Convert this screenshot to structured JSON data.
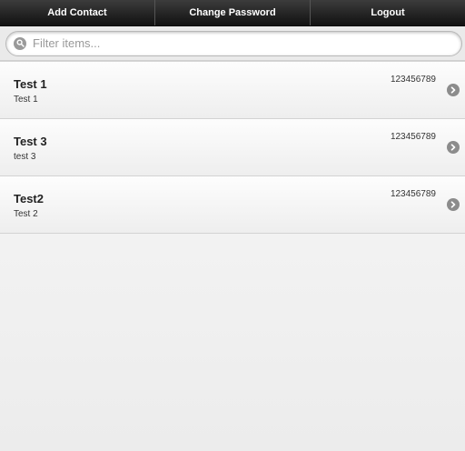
{
  "navbar": {
    "items": [
      {
        "label": "Add Contact"
      },
      {
        "label": "Change Password"
      },
      {
        "label": "Logout"
      }
    ]
  },
  "filter": {
    "placeholder": "Filter items...",
    "icon": "search-icon"
  },
  "contacts": [
    {
      "name": "Test 1",
      "detail": "Test 1",
      "phone": "123456789",
      "icon": "chevron-right-icon"
    },
    {
      "name": "Test 3",
      "detail": "test 3",
      "phone": "123456789",
      "icon": "chevron-right-icon"
    },
    {
      "name": "Test2",
      "detail": "Test 2",
      "phone": "123456789",
      "icon": "chevron-right-icon"
    }
  ]
}
